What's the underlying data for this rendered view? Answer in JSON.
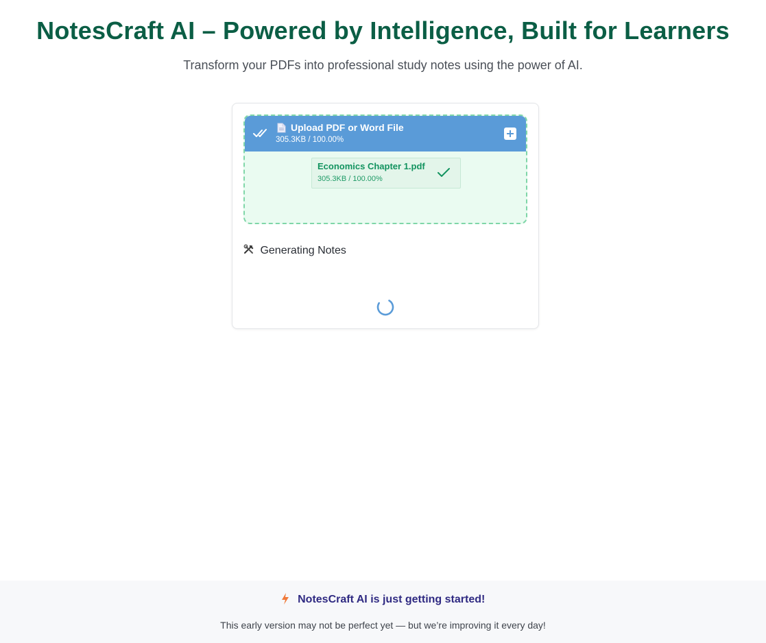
{
  "header": {
    "title": "NotesCraft AI – Powered by Intelligence, Built for Learners",
    "subtitle": "Transform your PDFs into professional study notes using the power of AI."
  },
  "upload": {
    "title": "Upload PDF or Word File",
    "progress_text": "305.3KB / 100.00%",
    "icons": [
      "double-check-icon",
      "document-icon",
      "plus-icon"
    ],
    "file": {
      "name": "Economics Chapter 1.pdf",
      "progress_text": "305.3KB / 100.00%",
      "progress_percent": 100,
      "status_icon": "check-icon"
    }
  },
  "status": {
    "icon": "hammer-wrench-icon",
    "text": "Generating Notes",
    "loading": true
  },
  "footer": {
    "headline": "NotesCraft AI is just getting started!",
    "headline_icon": "lightning-icon",
    "note": "This early version may not be perfect yet — but we’re improving it every day!"
  },
  "colors": {
    "brand_green": "#0b5e45",
    "upload_header_blue": "#5a9bd8",
    "dropzone_bg": "#eafbf1",
    "success_green": "#12935f",
    "footer_headline": "#2f2a82",
    "bolt_orange": "#f07a3a"
  }
}
